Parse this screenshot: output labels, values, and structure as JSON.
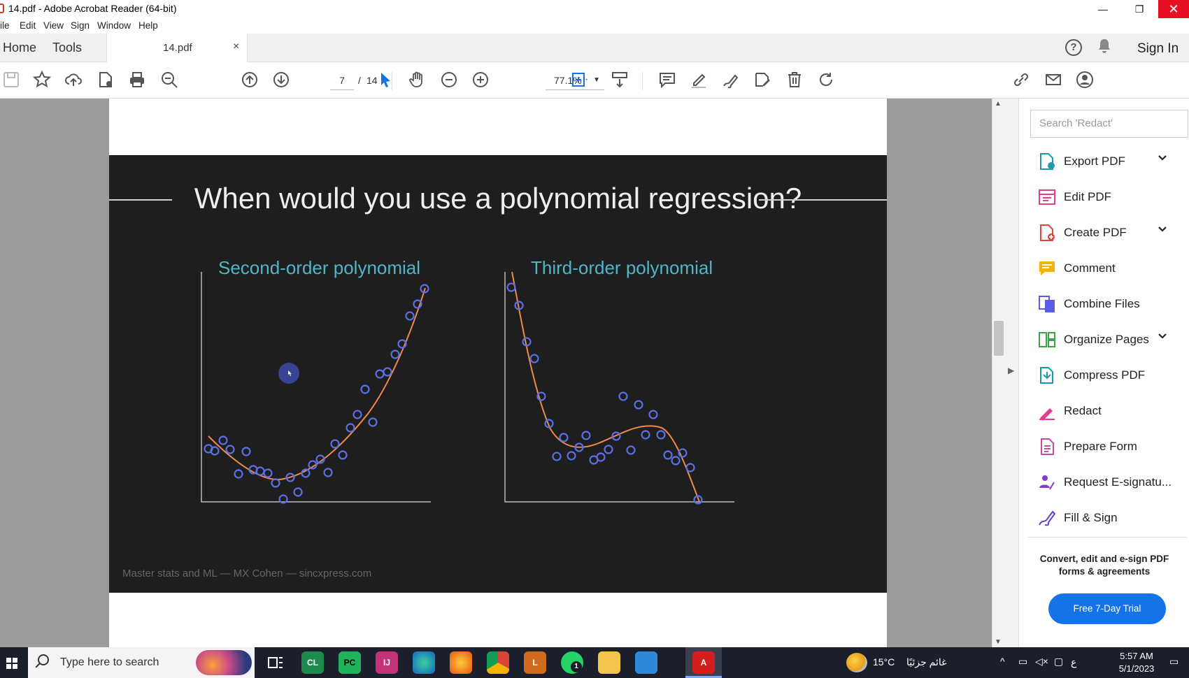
{
  "window": {
    "title": "14.pdf - Adobe Acrobat Reader (64-bit)",
    "minimize": "—",
    "maximize": "❐",
    "close": "✕"
  },
  "menu": [
    "ile",
    "Edit",
    "View",
    "Sign",
    "Window",
    "Help"
  ],
  "tabs": {
    "home": "Home",
    "tools": "Tools",
    "doc": "14.pdf",
    "doc_close": "×",
    "help": "?",
    "sign_in": "Sign In"
  },
  "toolbar": {
    "current_page": "7",
    "separator": "/",
    "total_pages": "14",
    "zoom": "77.1%"
  },
  "slide": {
    "title": "When would you use a polynomial regression?",
    "left_subtitle": "Second-order polynomial",
    "right_subtitle": "Third-order polynomial",
    "footer": "Master stats and ML — MX Cohen — sincxpress.com",
    "colors": {
      "background": "#1e1e1e",
      "subtitle": "#4fb6c9",
      "curve": "#f08a4b",
      "points": "#5a6fe6"
    }
  },
  "right_pane": {
    "search_placeholder": "Search 'Redact'",
    "tools": [
      {
        "label": "Export PDF",
        "icon": "export-pdf-icon",
        "color": "#1b9aaa",
        "has_chevron": true
      },
      {
        "label": "Edit PDF",
        "icon": "edit-pdf-icon",
        "color": "#e03e8c",
        "has_chevron": false
      },
      {
        "label": "Create PDF",
        "icon": "create-pdf-icon",
        "color": "#e0443e",
        "has_chevron": true
      },
      {
        "label": "Comment",
        "icon": "comment-icon",
        "color": "#f2b400",
        "has_chevron": false
      },
      {
        "label": "Combine Files",
        "icon": "combine-files-icon",
        "color": "#5a5ce6",
        "has_chevron": false
      },
      {
        "label": "Organize Pages",
        "icon": "organize-pages-icon",
        "color": "#3aa34a",
        "has_chevron": true
      },
      {
        "label": "Compress PDF",
        "icon": "compress-pdf-icon",
        "color": "#1b9aaa",
        "has_chevron": false
      },
      {
        "label": "Redact",
        "icon": "redact-icon",
        "color": "#e03e8c",
        "has_chevron": false
      },
      {
        "label": "Prepare Form",
        "icon": "prepare-form-icon",
        "color": "#c94aa0",
        "has_chevron": false
      },
      {
        "label": "Request E-signatu...",
        "icon": "request-esign-icon",
        "color": "#8a3ac9",
        "has_chevron": false
      },
      {
        "label": "Fill & Sign",
        "icon": "fill-sign-icon",
        "color": "#6a3ac9",
        "has_chevron": false
      }
    ],
    "promo_line1": "Convert, edit and e-sign PDF",
    "promo_line2": "forms & agreements",
    "trial_button": "Free 7-Day Trial"
  },
  "taskbar": {
    "search_text": "Type here to search",
    "weather": "15°C",
    "weather_desc": "غائم جزئيًا",
    "lang": "ع",
    "time": "5:57 AM",
    "date": "5/1/2023",
    "whatsapp_badge": "1"
  }
}
